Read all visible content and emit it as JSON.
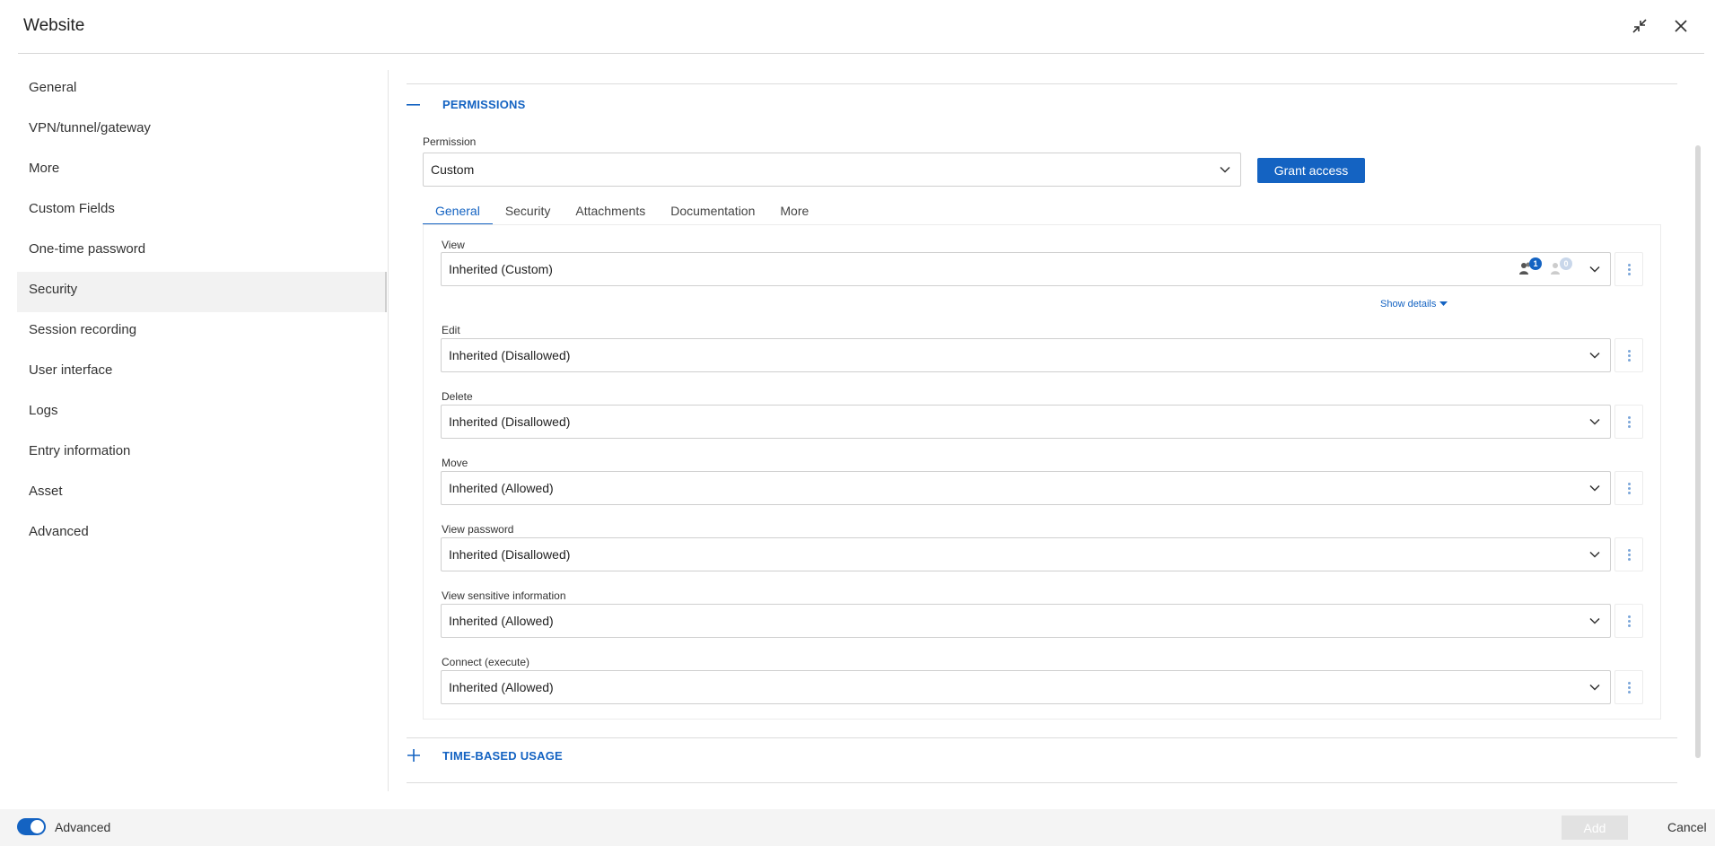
{
  "window": {
    "title": "Website",
    "collapse_icon": "collapse-arrows-icon",
    "close_icon": "close-icon"
  },
  "sidebar": {
    "items": [
      {
        "label": "General"
      },
      {
        "label": "VPN/tunnel/gateway"
      },
      {
        "label": "More"
      },
      {
        "label": "Custom Fields"
      },
      {
        "label": "One-time password"
      },
      {
        "label": "Security",
        "active": true
      },
      {
        "label": "Session recording"
      },
      {
        "label": "User interface"
      },
      {
        "label": "Logs"
      },
      {
        "label": "Entry information"
      },
      {
        "label": "Asset"
      },
      {
        "label": "Advanced"
      }
    ]
  },
  "permissions_section": {
    "title": "PERMISSIONS",
    "toggle": "—",
    "permission_label": "Permission",
    "permission_value": "Custom",
    "grant_button": "Grant access",
    "tabs": [
      "General",
      "Security",
      "Attachments",
      "Documentation",
      "More"
    ],
    "active_tab": "General",
    "view": {
      "label": "View",
      "value": "Inherited (Custom)",
      "users_count": "1",
      "roles_count": "0",
      "show_details": "Show details"
    },
    "fields": [
      {
        "label": "Edit",
        "value": "Inherited (Disallowed)"
      },
      {
        "label": "Delete",
        "value": "Inherited (Disallowed)"
      },
      {
        "label": "Move",
        "value": "Inherited (Allowed)"
      },
      {
        "label": "View password",
        "value": "Inherited (Disallowed)"
      },
      {
        "label": "View sensitive information",
        "value": "Inherited (Allowed)"
      },
      {
        "label": "Connect (execute)",
        "value": "Inherited (Allowed)"
      }
    ]
  },
  "time_section": {
    "title": "TIME-BASED USAGE",
    "toggle": "+"
  },
  "footer": {
    "advanced_label": "Advanced",
    "advanced_on": true,
    "add_button": "Add",
    "cancel_button": "Cancel"
  },
  "colors": {
    "accent": "#1463c2"
  }
}
